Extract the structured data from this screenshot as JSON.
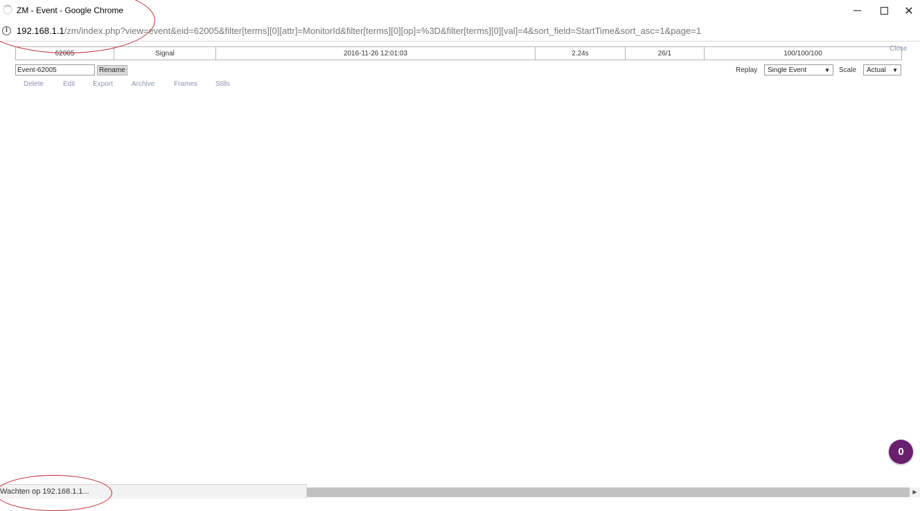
{
  "window": {
    "title": "ZM - Event - Google Chrome",
    "controls": {
      "minimize": "minimize",
      "maximize": "maximize",
      "close": "✕"
    }
  },
  "address": {
    "host": "192.168.1.1",
    "path": "/zm/index.php?view=event&eid=62005&filter[terms][0][attr]=MonitorId&filter[terms][0][op]=%3D&filter[terms][0][val]=4&sort_field=StartTime&sort_asc=1&page=1"
  },
  "event": {
    "id": "62005",
    "cause": "Signal",
    "start_time": "2016-11-26 12:01:03",
    "duration": "2.24s",
    "frames": "26/1",
    "scores": "100/100/100"
  },
  "close_label": "Close",
  "rename": {
    "value": "Event-62005",
    "button_label": "Rename"
  },
  "replay": {
    "label": "Replay",
    "value": "Single Event"
  },
  "scale": {
    "label": "Scale",
    "value": "Actual"
  },
  "actions": [
    "Delete",
    "Edit",
    "Export",
    "Archive",
    "Frames",
    "Stills"
  ],
  "status": "Wachten op 192.168.1.1...",
  "badge": "0",
  "colors": {
    "link": "#8a92b2",
    "badge": "#6a1f6e",
    "annotation": "#c0282e"
  },
  "icons": {
    "info": "info-icon",
    "spinner": "loading-spinner-icon",
    "scroll": "scroll-right-arrow-icon"
  }
}
